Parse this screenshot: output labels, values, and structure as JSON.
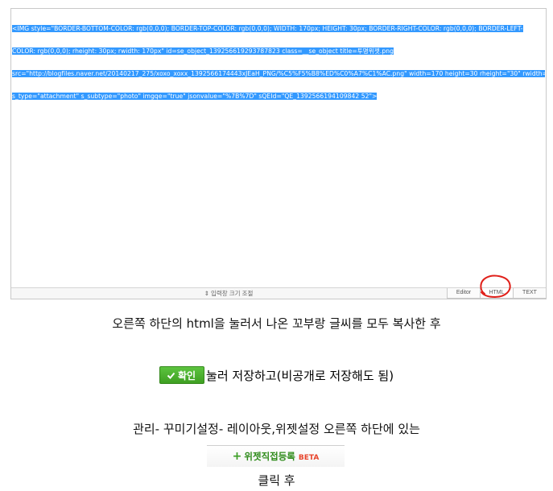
{
  "editor": {
    "code_lines": [
      "<IMG style=\"BORDER-BOTTOM-COLOR: rgb(0,0,0); BORDER-TOP-COLOR: rgb(0,0,0); WIDTH: 170px; HEIGHT: 30px; BORDER-RIGHT-COLOR: rgb(0,0,0); BORDER-LEFT-",
      "COLOR: rgb(0,0,0); rheight: 30px; rwidth: 170px\" id=se_object_139256619293787823 class=__se_object title=투명위젯.png",
      "src=\"http://blogfiles.naver.net/20140217_275/xoxo_xoxx_1392566174443xJEaH_PNG/%C5%F5%B8%ED%C0%A7%C1%AC.png\" width=170 height=30 rheight=\"30\" rwidth=\"170\"",
      "s_type=\"attachment\" s_subtype=\"photo\" imgqe=\"true\" jsonvalue=\"%7B%7D\" sQEId=\"QE_1392566194109842 52\">"
    ],
    "resize_label": "⇕ 입력창 크기 조절",
    "tabs": {
      "editor": "Editor",
      "html": "HTML",
      "text": "TEXT"
    }
  },
  "instructions": {
    "step1": "오른쪽 하단의 html을 눌러서 나온 꼬부랑 글씨를 모두 복사한 후",
    "confirm_button": "확인",
    "step2": "눌러 저장하고(비공개로 저장해도 됨)",
    "step3": "관리- 꾸미기설정- 레이아웃,위젯설정 오른쪽 하단에 있는",
    "widget_button": "위젯직접등록",
    "widget_badge": "BETA",
    "step4": "클릭 후"
  },
  "colors": {
    "selection": "#3399ff",
    "annotation_circle": "#e0201a",
    "confirm_green": "#4bb12e",
    "widget_green": "#2e8b1a",
    "beta_red": "#e8452c"
  }
}
